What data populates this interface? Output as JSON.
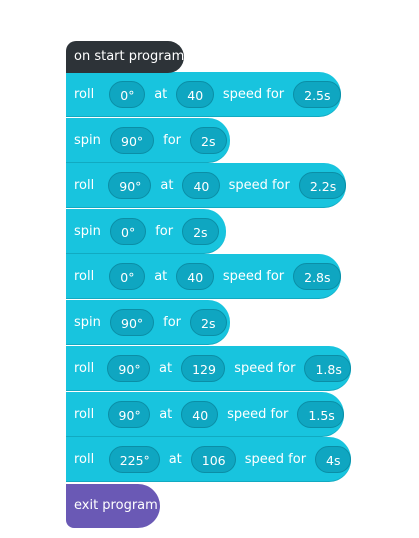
{
  "start_label": "on start program",
  "exit_label": "exit program",
  "blocks": [
    {
      "type": "roll",
      "keyword": "roll",
      "angle": "0°",
      "at_label": "at",
      "speed": "40",
      "speed_for_label": "speed for",
      "duration": "2.5s"
    },
    {
      "type": "spin",
      "keyword": "spin",
      "angle": "90°",
      "for_label": "for",
      "duration": "2s"
    },
    {
      "type": "roll",
      "keyword": "roll",
      "angle": "90°",
      "at_label": "at",
      "speed": "40",
      "speed_for_label": "speed for",
      "duration": "2.2s"
    },
    {
      "type": "spin",
      "keyword": "spin",
      "angle": "0°",
      "for_label": "for",
      "duration": "2s"
    },
    {
      "type": "roll",
      "keyword": "roll",
      "angle": "0°",
      "at_label": "at",
      "speed": "40",
      "speed_for_label": "speed for",
      "duration": "2.8s"
    },
    {
      "type": "spin",
      "keyword": "spin",
      "angle": "90°",
      "for_label": "for",
      "duration": "2s"
    },
    {
      "type": "roll",
      "keyword": "roll",
      "angle": "90°",
      "at_label": "at",
      "speed": "129",
      "speed_for_label": "speed for",
      "duration": "1.8s"
    },
    {
      "type": "roll",
      "keyword": "roll",
      "angle": "90°",
      "at_label": "at",
      "speed": "40",
      "speed_for_label": "speed for",
      "duration": "1.5s"
    },
    {
      "type": "roll",
      "keyword": "roll",
      "angle": "225°",
      "at_label": "at",
      "speed": "106",
      "speed_for_label": "speed for",
      "duration": "4s"
    }
  ],
  "colors": {
    "start_block": "#2d3338",
    "movement_block": "#18c4de",
    "value_pill": "#0fa6c1",
    "exit_block": "#6a59b5"
  }
}
